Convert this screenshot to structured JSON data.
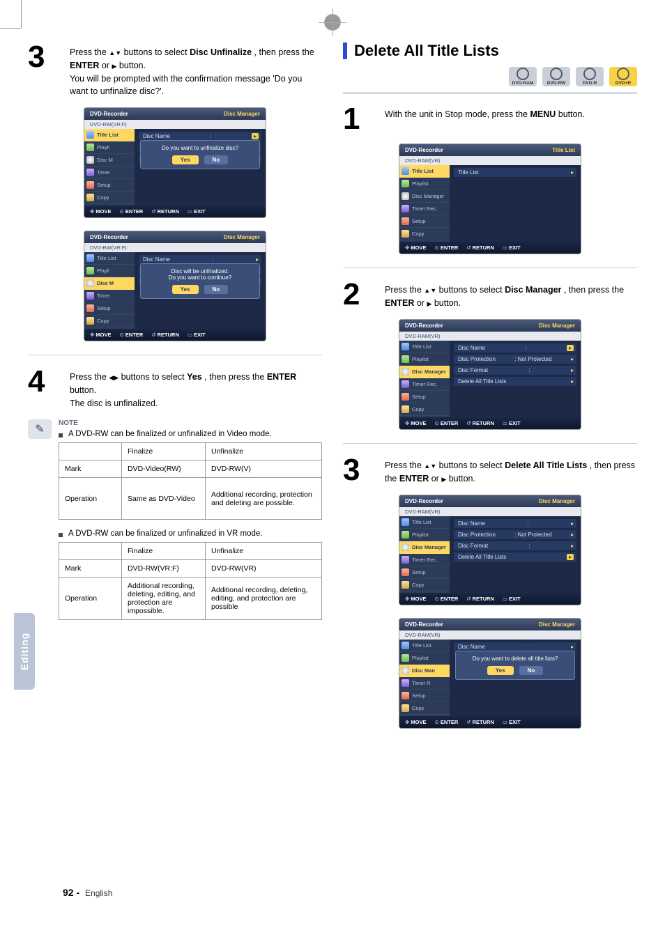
{
  "page": {
    "number": "92 -",
    "lang": "English",
    "sideTab": "Editing"
  },
  "left": {
    "step3": {
      "num": "3",
      "text_a": "Press the ",
      "text_b": " buttons to select ",
      "bold1": "Disc Unfinalize",
      "text_c": ", then press the ",
      "bold2": "ENTER",
      "text_d": " or ",
      "text_e": " button.",
      "extra": "You will be prompted with the confirmation message 'Do you want to unfinalize disc?'."
    },
    "step4": {
      "num": "4",
      "text_a": "Press the ",
      "text_b": " buttons to select ",
      "bold1": "Yes",
      "text_c": ", then press the ",
      "bold2": "ENTER",
      "text_d": " button.",
      "extra": "The disc is unfinalized."
    },
    "osd1": {
      "title": "DVD-Recorder",
      "titleRight": "Disc Manager",
      "sub": "DVD-RW(VR:F)",
      "nav": [
        "Title List",
        "Playli",
        "Disc M",
        "Timer",
        "Setup",
        "Copy"
      ],
      "navSel": 0,
      "row": {
        "k": "Disc Name",
        "v": ":",
        "gold": true
      },
      "dialog": {
        "msg": "Do you want to unfinalize disc?",
        "yes": "Yes",
        "no": "No",
        "sel": "yes"
      }
    },
    "osd2": {
      "title": "DVD-Recorder",
      "titleRight": "Disc Manager",
      "sub": "DVD-RW(VR:F)",
      "nav": [
        "Title List",
        "Playli",
        "Disc M",
        "Timer",
        "Setup",
        "Copy"
      ],
      "navSel": 2,
      "row": {
        "k": "Disc Name",
        "v": ":",
        "gold": false
      },
      "dialog": {
        "msg": "Disc will be unfinalized.\nDo you want to continue?",
        "yes": "Yes",
        "no": "No",
        "sel": "yes"
      }
    },
    "foot": {
      "move": "MOVE",
      "enter": "ENTER",
      "return": "RETURN",
      "exit": "EXIT"
    },
    "note": {
      "label": "NOTE",
      "b1": "A DVD-RW can be finalized or unfinalized in Video mode.",
      "t1": {
        "h": [
          "",
          "Finalize",
          "Unfinalize"
        ],
        "r1": [
          "Mark",
          "DVD-Video(RW)",
          "DVD-RW(V)"
        ],
        "r2": [
          "Operation",
          "Same as DVD-Video",
          "Additional recording, protection and deleting are possible."
        ]
      },
      "b2": "A DVD-RW can be finalized or unfinalized in VR mode.",
      "t2": {
        "h": [
          "",
          "Finalize",
          "Unfinalize"
        ],
        "r1": [
          "Mark",
          "DVD-RW(VR:F)",
          "DVD-RW(VR)"
        ],
        "r2": [
          "Operation",
          "Additional recording, deleting, editing, and protection are impossible.",
          "Additional recording, deleting, editing, and protection are possible"
        ]
      }
    }
  },
  "right": {
    "heading": "Delete All Title Lists",
    "discs": [
      "DVD-RAM",
      "DVD-RW",
      "DVD-R",
      "DVD+R"
    ],
    "step1": {
      "num": "1",
      "text_a": "With the unit in Stop mode, press the ",
      "bold1": "MENU",
      "text_b": " button."
    },
    "step2": {
      "num": "2",
      "text_a": "Press the ",
      "text_b": " buttons to select ",
      "bold1": "Disc Manager",
      "text_c": ", then press the ",
      "bold2": "ENTER",
      "text_d": " or ",
      "text_e": " button."
    },
    "step3": {
      "num": "3",
      "text_a": "Press the ",
      "text_b": " buttons to select ",
      "bold1": "Delete All Title Lists",
      "text_c": ", then press the ",
      "bold2": "ENTER",
      "text_d": " or ",
      "text_e": " button."
    },
    "osd1": {
      "title": "DVD-Recorder",
      "titleRight": "Title List",
      "sub": "DVD-RAM(VR)",
      "nav": [
        "Title List",
        "Playlist",
        "Disc Manager",
        "Timer Rec.",
        "Setup",
        "Copy"
      ],
      "navSel": 0,
      "rows": [
        {
          "k": "Title List",
          "v": "",
          "gold": false
        }
      ]
    },
    "osd2": {
      "title": "DVD-Recorder",
      "titleRight": "Disc Manager",
      "sub": "DVD-RAM(VR)",
      "nav": [
        "Title List",
        "Playlist",
        "Disc Manager",
        "Timer Rec.",
        "Setup",
        "Copy"
      ],
      "navSel": 2,
      "rows": [
        {
          "k": "Disc Name",
          "v": ":",
          "gold": true
        },
        {
          "k": "Disc Protection",
          "v": ": Not Protected"
        },
        {
          "k": "Disc Format",
          "v": ":"
        },
        {
          "k": "Delete All Title Lists",
          "v": ""
        }
      ]
    },
    "osd3": {
      "title": "DVD-Recorder",
      "titleRight": "Disc Manager",
      "sub": "DVD-RAM(VR)",
      "nav": [
        "Title List",
        "Playlist",
        "Disc Manager",
        "Timer Rec.",
        "Setup",
        "Copy"
      ],
      "navSel": 2,
      "rows": [
        {
          "k": "Disc Name",
          "v": ":"
        },
        {
          "k": "Disc Protection",
          "v": ": Not Protected"
        },
        {
          "k": "Disc Format",
          "v": ":"
        },
        {
          "k": "Delete All Title Lists",
          "v": "",
          "gold": true
        }
      ]
    },
    "osd4": {
      "title": "DVD-Recorder",
      "titleRight": "Disc Manager",
      "sub": "DVD-RAM(VR)",
      "nav": [
        "Title List",
        "Playlist",
        "Disc Man",
        "Timer R",
        "Setup",
        "Copy"
      ],
      "navSel": 2,
      "row": {
        "k": "Disc Name",
        "v": ":"
      },
      "dialog": {
        "msg": "Do you want to delete all title lists?",
        "yes": "Yes",
        "no": "No",
        "sel": "yes"
      }
    },
    "foot": {
      "move": "MOVE",
      "enter": "ENTER",
      "return": "RETURN",
      "exit": "EXIT"
    }
  }
}
